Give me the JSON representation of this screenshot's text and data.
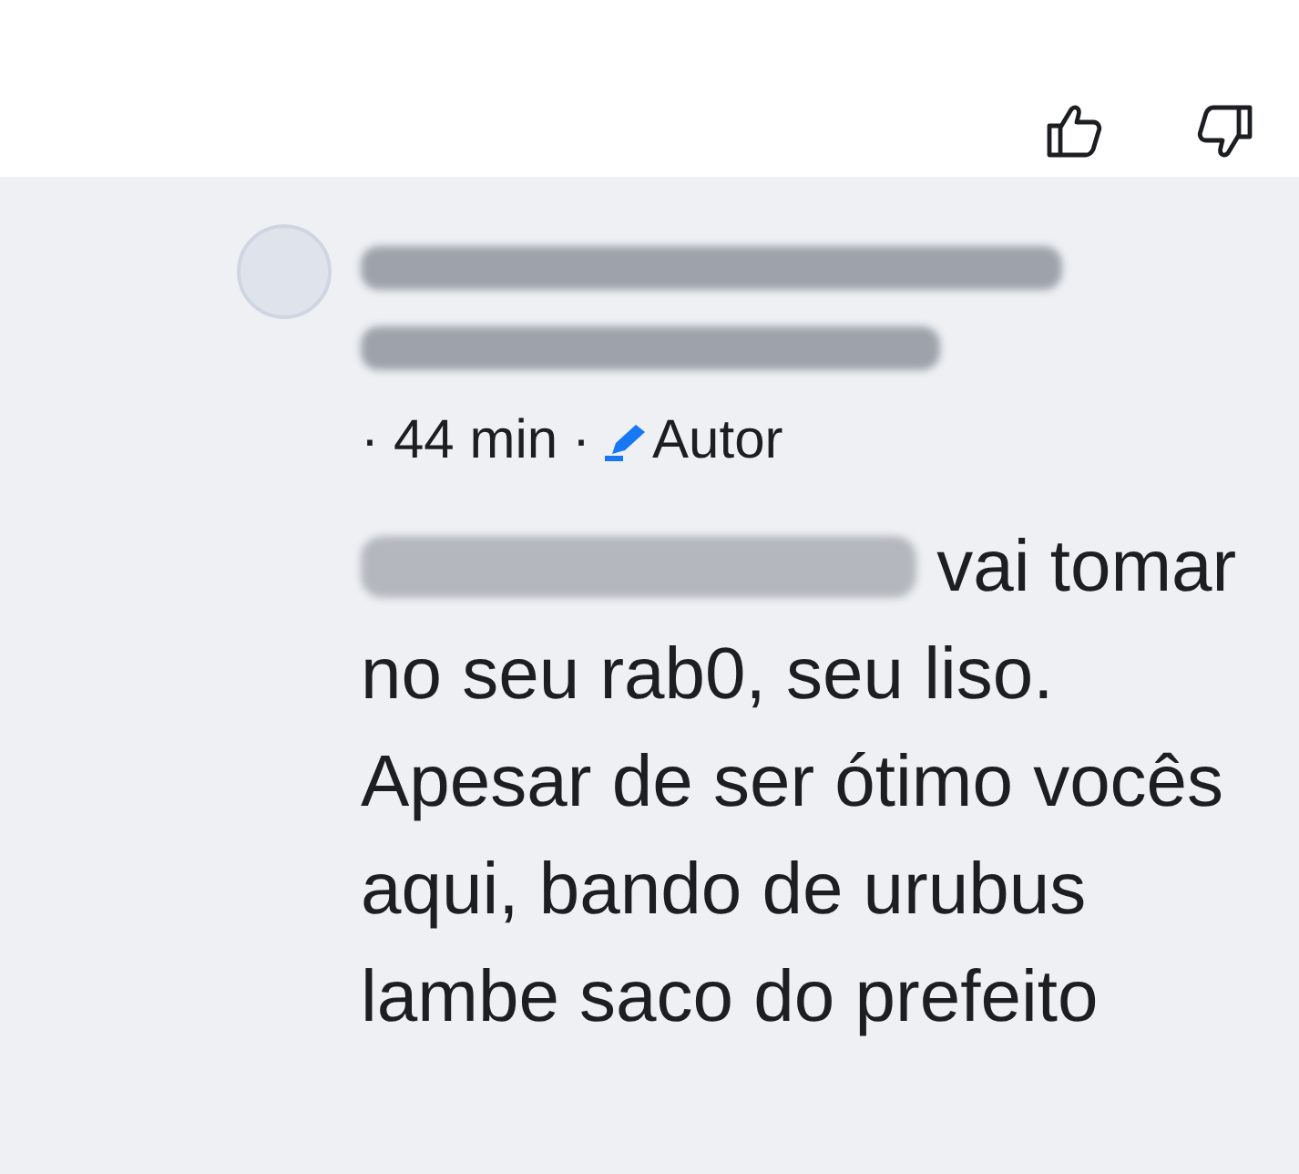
{
  "reactions": [
    {
      "kind": "like"
    },
    {
      "kind": "dislike"
    }
  ],
  "comment": {
    "meta": [
      {
        "kind": "separator",
        "text": "·"
      },
      {
        "kind": "time",
        "text": "44 min"
      },
      {
        "kind": "separator",
        "text": "·"
      },
      {
        "kind": "badge",
        "text": "Autor"
      }
    ],
    "text": "vai tomar no seu rab0, seu liso. Apesar de ser ótimo vocês aqui, bando de urubus lambe saco do prefeito"
  }
}
